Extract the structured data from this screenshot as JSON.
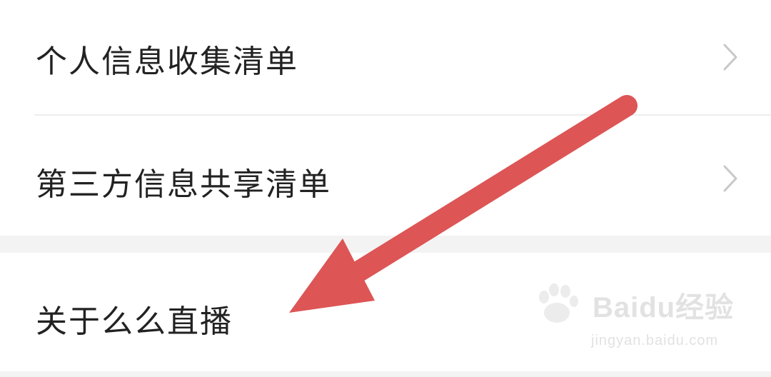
{
  "menu": {
    "items": [
      {
        "label": "个人信息收集清单",
        "chevron_icon": "chevron-right-icon"
      },
      {
        "label": "第三方信息共享清单",
        "chevron_icon": "chevron-right-icon"
      },
      {
        "label": "关于么么直播"
      }
    ]
  },
  "annotation": {
    "arrow_icon": "arrow-annotation-icon",
    "arrow_color": "#dd5555"
  },
  "watermark": {
    "logo_text": "Baidu经验",
    "url_text": "jingyan.baidu.com"
  },
  "colors": {
    "text": "#222222",
    "chevron": "#c8c8c8",
    "divider": "#eeeeee",
    "section_gap": "#f3f3f3"
  }
}
